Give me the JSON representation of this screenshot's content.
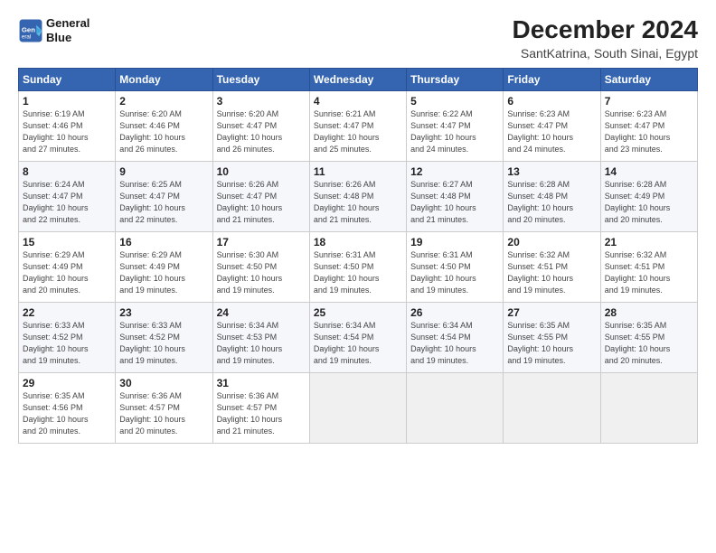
{
  "header": {
    "logo_line1": "General",
    "logo_line2": "Blue",
    "month": "December 2024",
    "location": "SantKatrina, South Sinai, Egypt"
  },
  "days_of_week": [
    "Sunday",
    "Monday",
    "Tuesday",
    "Wednesday",
    "Thursday",
    "Friday",
    "Saturday"
  ],
  "weeks": [
    [
      {
        "day": "1",
        "detail": "Sunrise: 6:19 AM\nSunset: 4:46 PM\nDaylight: 10 hours\nand 27 minutes."
      },
      {
        "day": "2",
        "detail": "Sunrise: 6:20 AM\nSunset: 4:46 PM\nDaylight: 10 hours\nand 26 minutes."
      },
      {
        "day": "3",
        "detail": "Sunrise: 6:20 AM\nSunset: 4:47 PM\nDaylight: 10 hours\nand 26 minutes."
      },
      {
        "day": "4",
        "detail": "Sunrise: 6:21 AM\nSunset: 4:47 PM\nDaylight: 10 hours\nand 25 minutes."
      },
      {
        "day": "5",
        "detail": "Sunrise: 6:22 AM\nSunset: 4:47 PM\nDaylight: 10 hours\nand 24 minutes."
      },
      {
        "day": "6",
        "detail": "Sunrise: 6:23 AM\nSunset: 4:47 PM\nDaylight: 10 hours\nand 24 minutes."
      },
      {
        "day": "7",
        "detail": "Sunrise: 6:23 AM\nSunset: 4:47 PM\nDaylight: 10 hours\nand 23 minutes."
      }
    ],
    [
      {
        "day": "8",
        "detail": "Sunrise: 6:24 AM\nSunset: 4:47 PM\nDaylight: 10 hours\nand 22 minutes."
      },
      {
        "day": "9",
        "detail": "Sunrise: 6:25 AM\nSunset: 4:47 PM\nDaylight: 10 hours\nand 22 minutes."
      },
      {
        "day": "10",
        "detail": "Sunrise: 6:26 AM\nSunset: 4:47 PM\nDaylight: 10 hours\nand 21 minutes."
      },
      {
        "day": "11",
        "detail": "Sunrise: 6:26 AM\nSunset: 4:48 PM\nDaylight: 10 hours\nand 21 minutes."
      },
      {
        "day": "12",
        "detail": "Sunrise: 6:27 AM\nSunset: 4:48 PM\nDaylight: 10 hours\nand 21 minutes."
      },
      {
        "day": "13",
        "detail": "Sunrise: 6:28 AM\nSunset: 4:48 PM\nDaylight: 10 hours\nand 20 minutes."
      },
      {
        "day": "14",
        "detail": "Sunrise: 6:28 AM\nSunset: 4:49 PM\nDaylight: 10 hours\nand 20 minutes."
      }
    ],
    [
      {
        "day": "15",
        "detail": "Sunrise: 6:29 AM\nSunset: 4:49 PM\nDaylight: 10 hours\nand 20 minutes."
      },
      {
        "day": "16",
        "detail": "Sunrise: 6:29 AM\nSunset: 4:49 PM\nDaylight: 10 hours\nand 19 minutes."
      },
      {
        "day": "17",
        "detail": "Sunrise: 6:30 AM\nSunset: 4:50 PM\nDaylight: 10 hours\nand 19 minutes."
      },
      {
        "day": "18",
        "detail": "Sunrise: 6:31 AM\nSunset: 4:50 PM\nDaylight: 10 hours\nand 19 minutes."
      },
      {
        "day": "19",
        "detail": "Sunrise: 6:31 AM\nSunset: 4:50 PM\nDaylight: 10 hours\nand 19 minutes."
      },
      {
        "day": "20",
        "detail": "Sunrise: 6:32 AM\nSunset: 4:51 PM\nDaylight: 10 hours\nand 19 minutes."
      },
      {
        "day": "21",
        "detail": "Sunrise: 6:32 AM\nSunset: 4:51 PM\nDaylight: 10 hours\nand 19 minutes."
      }
    ],
    [
      {
        "day": "22",
        "detail": "Sunrise: 6:33 AM\nSunset: 4:52 PM\nDaylight: 10 hours\nand 19 minutes."
      },
      {
        "day": "23",
        "detail": "Sunrise: 6:33 AM\nSunset: 4:52 PM\nDaylight: 10 hours\nand 19 minutes."
      },
      {
        "day": "24",
        "detail": "Sunrise: 6:34 AM\nSunset: 4:53 PM\nDaylight: 10 hours\nand 19 minutes."
      },
      {
        "day": "25",
        "detail": "Sunrise: 6:34 AM\nSunset: 4:54 PM\nDaylight: 10 hours\nand 19 minutes."
      },
      {
        "day": "26",
        "detail": "Sunrise: 6:34 AM\nSunset: 4:54 PM\nDaylight: 10 hours\nand 19 minutes."
      },
      {
        "day": "27",
        "detail": "Sunrise: 6:35 AM\nSunset: 4:55 PM\nDaylight: 10 hours\nand 19 minutes."
      },
      {
        "day": "28",
        "detail": "Sunrise: 6:35 AM\nSunset: 4:55 PM\nDaylight: 10 hours\nand 20 minutes."
      }
    ],
    [
      {
        "day": "29",
        "detail": "Sunrise: 6:35 AM\nSunset: 4:56 PM\nDaylight: 10 hours\nand 20 minutes."
      },
      {
        "day": "30",
        "detail": "Sunrise: 6:36 AM\nSunset: 4:57 PM\nDaylight: 10 hours\nand 20 minutes."
      },
      {
        "day": "31",
        "detail": "Sunrise: 6:36 AM\nSunset: 4:57 PM\nDaylight: 10 hours\nand 21 minutes."
      },
      {
        "day": "",
        "detail": ""
      },
      {
        "day": "",
        "detail": ""
      },
      {
        "day": "",
        "detail": ""
      },
      {
        "day": "",
        "detail": ""
      }
    ]
  ]
}
